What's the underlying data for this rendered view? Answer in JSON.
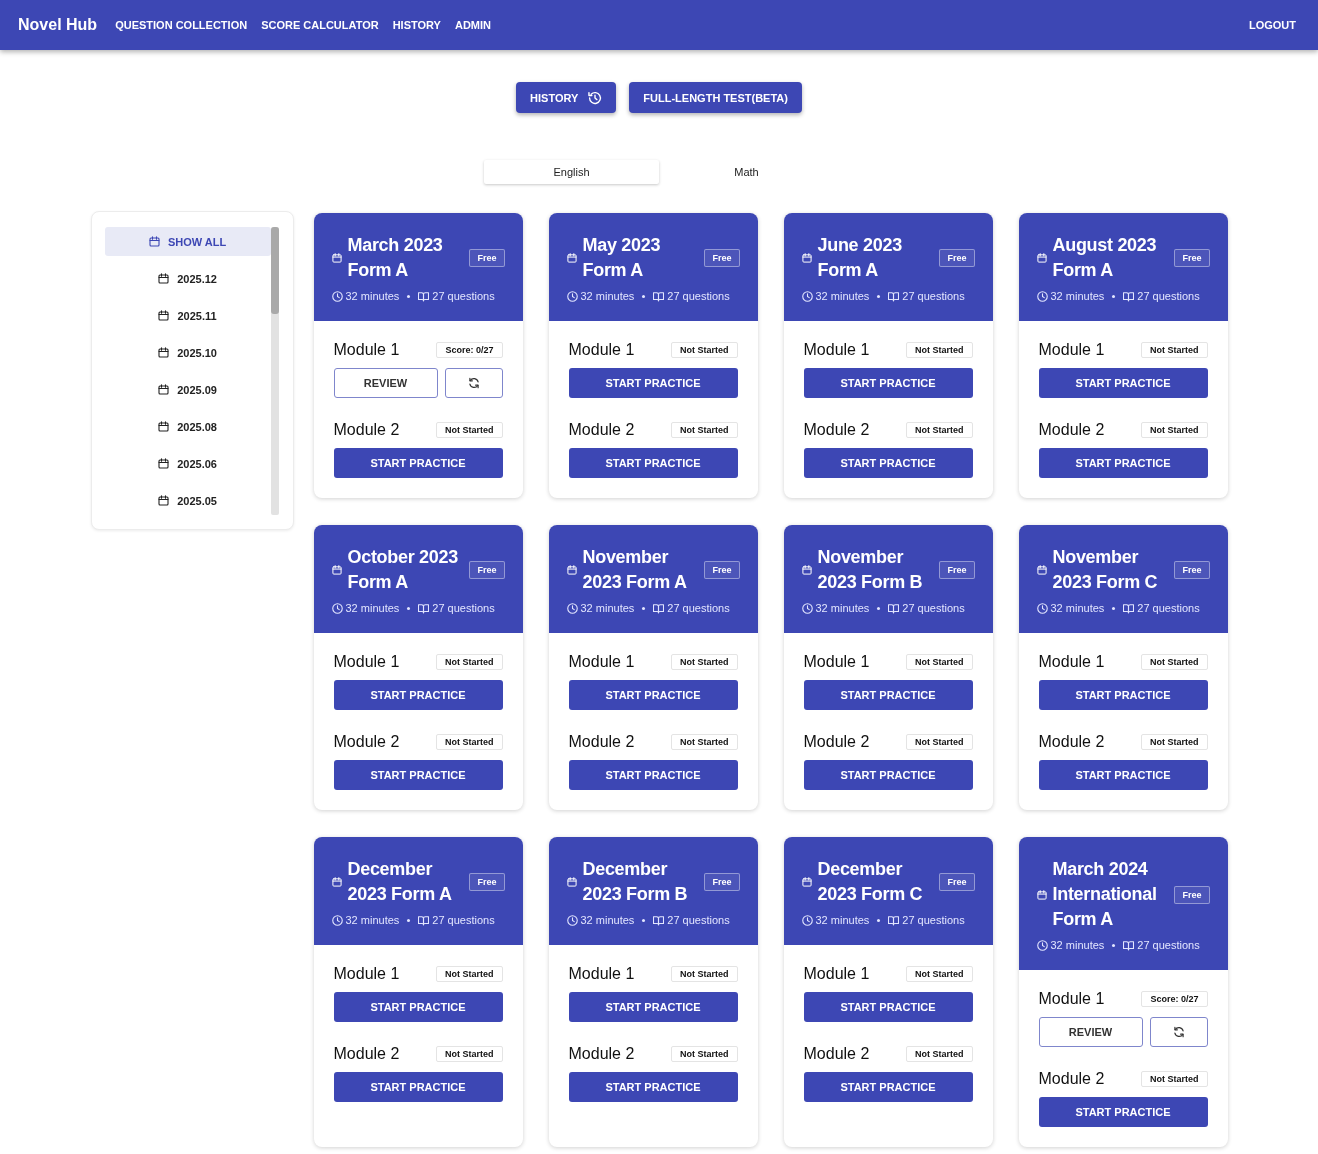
{
  "nav": {
    "brand": "Novel Hub",
    "links": [
      {
        "label": "QUESTION COLLECTION"
      },
      {
        "label": "SCORE CALCULATOR"
      },
      {
        "label": "HISTORY"
      },
      {
        "label": "ADMIN"
      }
    ],
    "logout": "LOGOUT"
  },
  "actions": [
    {
      "label": "HISTORY",
      "kind": "history"
    },
    {
      "label": "FULL-LENGTH TEST(BETA)",
      "kind": "test"
    }
  ],
  "subject_tabs": [
    {
      "label": "English",
      "selected": true
    },
    {
      "label": "Math",
      "selected": false
    }
  ],
  "sidebar": {
    "items": [
      {
        "label": "SHOW ALL",
        "selected": true
      },
      {
        "label": "2025.12",
        "selected": false
      },
      {
        "label": "2025.11",
        "selected": false
      },
      {
        "label": "2025.10",
        "selected": false
      },
      {
        "label": "2025.09",
        "selected": false
      },
      {
        "label": "2025.08",
        "selected": false
      },
      {
        "label": "2025.06",
        "selected": false
      },
      {
        "label": "2025.05",
        "selected": false
      }
    ]
  },
  "tests": [
    {
      "title": "March 2023 Form A",
      "badge": "Free",
      "duration": "32 minutes",
      "questions": "27 questions",
      "modules": [
        {
          "name": "Module 1",
          "status": "Score: 0/27",
          "kind": "review",
          "button": "REVIEW"
        },
        {
          "name": "Module 2",
          "status": "Not Started",
          "kind": "start",
          "button": "START PRACTICE"
        }
      ]
    },
    {
      "title": "May 2023 Form A",
      "badge": "Free",
      "duration": "32 minutes",
      "questions": "27 questions",
      "modules": [
        {
          "name": "Module 1",
          "status": "Not Started",
          "kind": "start",
          "button": "START PRACTICE"
        },
        {
          "name": "Module 2",
          "status": "Not Started",
          "kind": "start",
          "button": "START PRACTICE"
        }
      ]
    },
    {
      "title": "June 2023 Form A",
      "badge": "Free",
      "duration": "32 minutes",
      "questions": "27 questions",
      "modules": [
        {
          "name": "Module 1",
          "status": "Not Started",
          "kind": "start",
          "button": "START PRACTICE"
        },
        {
          "name": "Module 2",
          "status": "Not Started",
          "kind": "start",
          "button": "START PRACTICE"
        }
      ]
    },
    {
      "title": "August 2023 Form A",
      "badge": "Free",
      "duration": "32 minutes",
      "questions": "27 questions",
      "modules": [
        {
          "name": "Module 1",
          "status": "Not Started",
          "kind": "start",
          "button": "START PRACTICE"
        },
        {
          "name": "Module 2",
          "status": "Not Started",
          "kind": "start",
          "button": "START PRACTICE"
        }
      ]
    },
    {
      "title": "October 2023 Form A",
      "badge": "Free",
      "duration": "32 minutes",
      "questions": "27 questions",
      "modules": [
        {
          "name": "Module 1",
          "status": "Not Started",
          "kind": "start",
          "button": "START PRACTICE"
        },
        {
          "name": "Module 2",
          "status": "Not Started",
          "kind": "start",
          "button": "START PRACTICE"
        }
      ]
    },
    {
      "title": "November 2023 Form A",
      "badge": "Free",
      "duration": "32 minutes",
      "questions": "27 questions",
      "modules": [
        {
          "name": "Module 1",
          "status": "Not Started",
          "kind": "start",
          "button": "START PRACTICE"
        },
        {
          "name": "Module 2",
          "status": "Not Started",
          "kind": "start",
          "button": "START PRACTICE"
        }
      ]
    },
    {
      "title": "November 2023 Form B",
      "badge": "Free",
      "duration": "32 minutes",
      "questions": "27 questions",
      "modules": [
        {
          "name": "Module 1",
          "status": "Not Started",
          "kind": "start",
          "button": "START PRACTICE"
        },
        {
          "name": "Module 2",
          "status": "Not Started",
          "kind": "start",
          "button": "START PRACTICE"
        }
      ]
    },
    {
      "title": "November 2023 Form C",
      "badge": "Free",
      "duration": "32 minutes",
      "questions": "27 questions",
      "modules": [
        {
          "name": "Module 1",
          "status": "Not Started",
          "kind": "start",
          "button": "START PRACTICE"
        },
        {
          "name": "Module 2",
          "status": "Not Started",
          "kind": "start",
          "button": "START PRACTICE"
        }
      ]
    },
    {
      "title": "December 2023 Form A",
      "badge": "Free",
      "duration": "32 minutes",
      "questions": "27 questions",
      "modules": [
        {
          "name": "Module 1",
          "status": "Not Started",
          "kind": "start",
          "button": "START PRACTICE"
        },
        {
          "name": "Module 2",
          "status": "Not Started",
          "kind": "start",
          "button": "START PRACTICE"
        }
      ]
    },
    {
      "title": "December 2023 Form B",
      "badge": "Free",
      "duration": "32 minutes",
      "questions": "27 questions",
      "modules": [
        {
          "name": "Module 1",
          "status": "Not Started",
          "kind": "start",
          "button": "START PRACTICE"
        },
        {
          "name": "Module 2",
          "status": "Not Started",
          "kind": "start",
          "button": "START PRACTICE"
        }
      ]
    },
    {
      "title": "December 2023 Form C",
      "badge": "Free",
      "duration": "32 minutes",
      "questions": "27 questions",
      "modules": [
        {
          "name": "Module 1",
          "status": "Not Started",
          "kind": "start",
          "button": "START PRACTICE"
        },
        {
          "name": "Module 2",
          "status": "Not Started",
          "kind": "start",
          "button": "START PRACTICE"
        }
      ]
    },
    {
      "title": "March 2024 International Form A",
      "badge": "Free",
      "duration": "32 minutes",
      "questions": "27 questions",
      "modules": [
        {
          "name": "Module 1",
          "status": "Score: 0/27",
          "kind": "review",
          "button": "REVIEW"
        },
        {
          "name": "Module 2",
          "status": "Not Started",
          "kind": "start",
          "button": "START PRACTICE"
        }
      ]
    }
  ]
}
